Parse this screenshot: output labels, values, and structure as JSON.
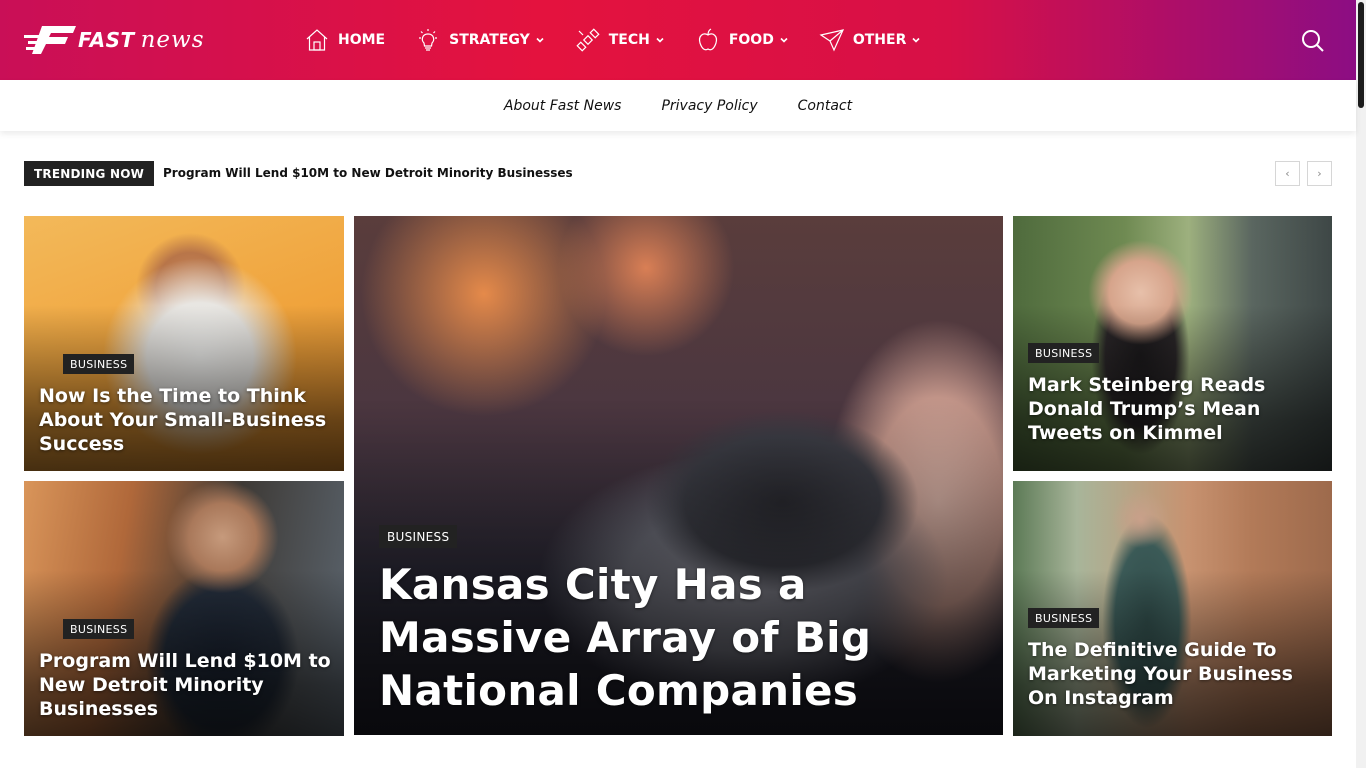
{
  "header": {
    "logo": {
      "word1": "FAST",
      "word2": "news"
    },
    "nav": [
      {
        "label": "HOME",
        "icon": "home-icon",
        "has_dropdown": false
      },
      {
        "label": "STRATEGY",
        "icon": "lightbulb-icon",
        "has_dropdown": true
      },
      {
        "label": "TECH",
        "icon": "satellite-icon",
        "has_dropdown": true
      },
      {
        "label": "FOOD",
        "icon": "apple-icon",
        "has_dropdown": true
      },
      {
        "label": "OTHER",
        "icon": "paper-plane-icon",
        "has_dropdown": true
      }
    ],
    "search_icon": "search-icon",
    "colors": {
      "gradient_start": "#c90f57",
      "gradient_mid": "#e4123e",
      "gradient_end": "#8c0d83"
    }
  },
  "subnav": [
    {
      "label": "About Fast News"
    },
    {
      "label": "Privacy Policy"
    },
    {
      "label": "Contact"
    }
  ],
  "trending": {
    "label": "TRENDING NOW",
    "title": "Program Will Lend $10M to New Detroit Minority Businesses",
    "prev_icon": "chevron-left-icon",
    "next_icon": "chevron-right-icon"
  },
  "articles": [
    {
      "category": "BUSINESS",
      "title": "Now Is the Time to Think About Your Small-Business Success"
    },
    {
      "category": "BUSINESS",
      "title": "Program Will Lend $10M to New Detroit Minority Businesses"
    },
    {
      "category": "BUSINESS",
      "title": "Kansas City Has a Massive Array of Big National Companies"
    },
    {
      "category": "BUSINESS",
      "title": "Mark Steinberg Reads Donald Trump’s Mean Tweets on Kimmel"
    },
    {
      "category": "BUSINESS",
      "title": "The Definitive Guide To Marketing Your Business On Instagram"
    }
  ]
}
